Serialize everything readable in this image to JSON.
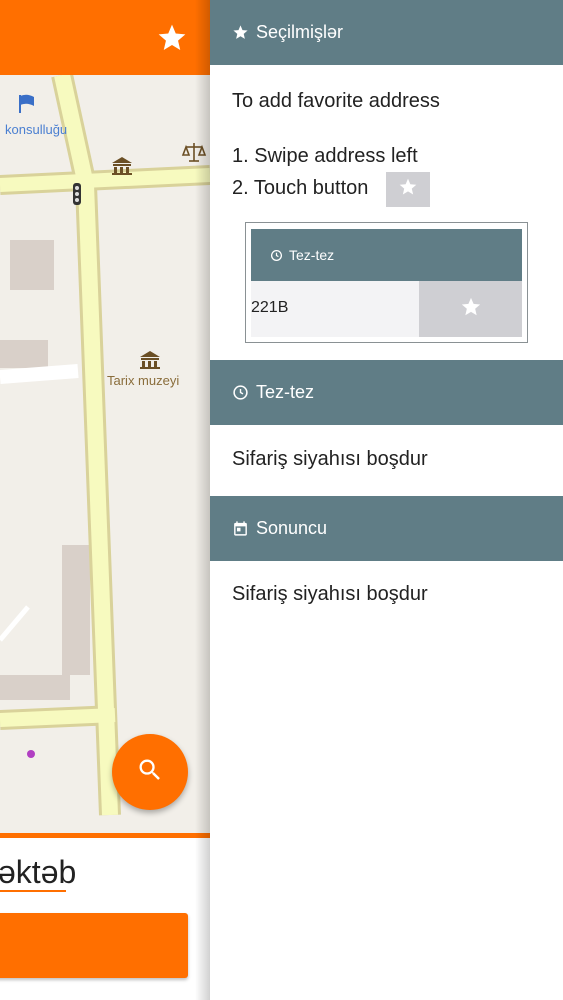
{
  "map": {
    "label_consulate": "konsulluğu",
    "label_museum": "Tarix muzeyi",
    "bottom_text": "əktəb"
  },
  "icons": {
    "favorites": "star-icon",
    "search": "search-icon",
    "frequent": "clock-icon",
    "recent": "calendar-icon"
  },
  "colors": {
    "accent": "#ff6f00",
    "section_header": "#607d86",
    "star_button": "#cfcfd3"
  },
  "drawer": {
    "favorites": {
      "title": "Seçilmişlər",
      "intro": "To add favorite address",
      "step1": "1. Swipe address left",
      "step2": "2. Touch button",
      "example": {
        "header": "Tez-tez",
        "address": "221B"
      }
    },
    "frequent": {
      "title": "Tez-tez",
      "empty_text": "Sifariş siyahısı boşdur"
    },
    "recent": {
      "title": "Sonuncu",
      "empty_text": "Sifariş siyahısı boşdur"
    }
  }
}
